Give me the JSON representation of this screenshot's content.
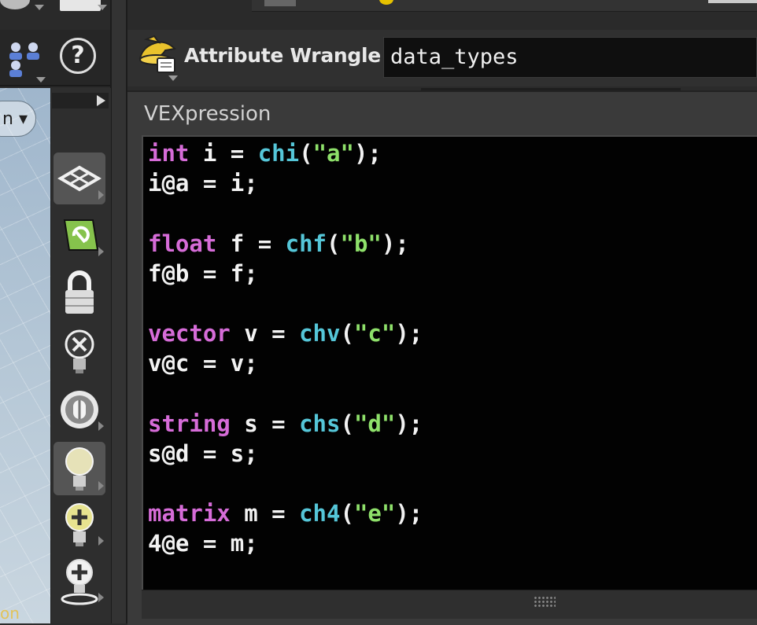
{
  "header": {
    "node_type_label": "Attribute Wrangle",
    "node_name": "data_types"
  },
  "parameter": {
    "label": "VEXpression"
  },
  "code": {
    "lines": [
      [
        {
          "t": "int",
          "c": "kw"
        },
        {
          "t": " i = ",
          "c": ""
        },
        {
          "t": "chi",
          "c": "fn"
        },
        {
          "t": "(",
          "c": ""
        },
        {
          "t": "\"a\"",
          "c": "st"
        },
        {
          "t": ");",
          "c": ""
        }
      ],
      [
        {
          "t": "i@a = i;",
          "c": ""
        }
      ],
      [],
      [
        {
          "t": "float",
          "c": "kw"
        },
        {
          "t": " f = ",
          "c": ""
        },
        {
          "t": "chf",
          "c": "fn"
        },
        {
          "t": "(",
          "c": ""
        },
        {
          "t": "\"b\"",
          "c": "st"
        },
        {
          "t": ");",
          "c": ""
        }
      ],
      [
        {
          "t": "f@b = f;",
          "c": ""
        }
      ],
      [],
      [
        {
          "t": "vector",
          "c": "kw"
        },
        {
          "t": " v = ",
          "c": ""
        },
        {
          "t": "chv",
          "c": "fn"
        },
        {
          "t": "(",
          "c": ""
        },
        {
          "t": "\"c\"",
          "c": "st"
        },
        {
          "t": ");",
          "c": ""
        }
      ],
      [
        {
          "t": "v@c = v;",
          "c": ""
        }
      ],
      [],
      [
        {
          "t": "string",
          "c": "kw"
        },
        {
          "t": " s = ",
          "c": ""
        },
        {
          "t": "chs",
          "c": "fn"
        },
        {
          "t": "(",
          "c": ""
        },
        {
          "t": "\"d\"",
          "c": "st"
        },
        {
          "t": ");",
          "c": ""
        }
      ],
      [
        {
          "t": "s@d = s;",
          "c": ""
        }
      ],
      [],
      [
        {
          "t": "matrix",
          "c": "kw"
        },
        {
          "t": " m = ",
          "c": ""
        },
        {
          "t": "ch4",
          "c": "fn"
        },
        {
          "t": "(",
          "c": ""
        },
        {
          "t": "\"e\"",
          "c": "st"
        },
        {
          "t": ");",
          "c": ""
        }
      ],
      [
        {
          "t": "4@e = m;",
          "c": ""
        }
      ]
    ]
  },
  "viewport": {
    "dropdown_label": "n ▾",
    "bottom_text": "on"
  },
  "toolbar": {
    "help_glyph": "?",
    "tools": [
      {
        "name": "display-plane-icon",
        "active": true
      },
      {
        "name": "snap-to-geometry-icon",
        "active": false
      },
      {
        "name": "lock-icon",
        "active": false
      },
      {
        "name": "light-off-icon",
        "active": false
      },
      {
        "name": "sphere-toggle-icon",
        "active": false
      },
      {
        "name": "light-bulb-icon",
        "active": true
      },
      {
        "name": "add-light-icon",
        "active": false
      },
      {
        "name": "light-target-icon",
        "active": false
      }
    ]
  },
  "colors": {
    "keyword": "#d66cd8",
    "function": "#55c6d8",
    "string": "#8ee06a",
    "text": "#f2f2f2",
    "editor_bg": "#020202"
  }
}
